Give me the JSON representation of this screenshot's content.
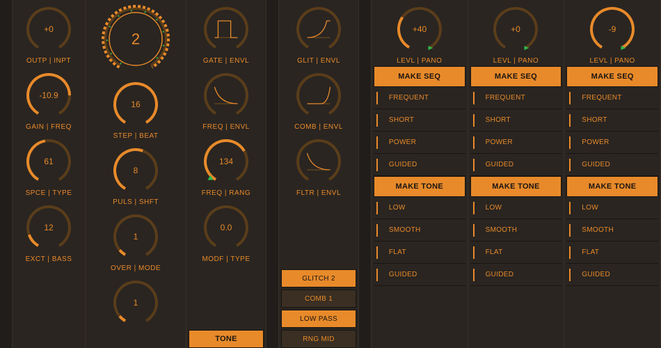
{
  "col1": {
    "k1": {
      "val": "+0",
      "label": "OUTP | INPT",
      "angle": 0
    },
    "k2": {
      "val": "-10.9",
      "label": "GAIN | FREQ",
      "angle": 240
    },
    "k3": {
      "val": "61",
      "label": "SPCE | TYPE",
      "angle": 140
    },
    "k4": {
      "val": "12",
      "label": "EXCT | BASS",
      "angle": 40
    }
  },
  "col2": {
    "k1": {
      "val": "2",
      "label": "",
      "angle": 300,
      "big": true,
      "green": true
    },
    "k2": {
      "val": "16",
      "label": "STEP | BEAT",
      "angle": 300
    },
    "k3": {
      "val": "8",
      "label": "PULS | SHFT",
      "angle": 170
    },
    "k4": {
      "val": "1",
      "label": "OVER | MODE",
      "angle": 20
    },
    "k5": {
      "val": "1",
      "label": "",
      "angle": 20
    }
  },
  "col3": {
    "k1": {
      "val": "",
      "label": "GATE | ENVL",
      "env": "gate"
    },
    "k2": {
      "val": "",
      "label": "FREQ | ENVL",
      "env": "decay"
    },
    "k3": {
      "val": "134",
      "label": "FREQ | RANG",
      "angle": 210,
      "green_tick": true
    },
    "k4": {
      "val": "0.0",
      "label": "MODF | TYPE",
      "angle": 0
    },
    "btn": "TONE"
  },
  "col5": {
    "k1": {
      "val": "",
      "label": "GLIT | ENVL",
      "env": "attack"
    },
    "k2": {
      "val": "",
      "label": "COMB | ENVL",
      "env": "late"
    },
    "k3": {
      "val": "",
      "label": "FLTR | ENVL",
      "env": "decay"
    },
    "buttons": [
      "GLITCH 2",
      "COMB 1",
      "LOW PASS",
      "RNG MID"
    ]
  },
  "right": {
    "knob_label": "LEVL | PANO",
    "seq_hdr": "MAKE SEQ",
    "seq_items": [
      "FREQUENT",
      "SHORT",
      "POWER",
      "GUIDED"
    ],
    "tone_hdr": "MAKE TONE",
    "tone_items": [
      "LOW",
      "SMOOTH",
      "FLAT",
      "GUIDED"
    ],
    "vals": [
      "+40",
      "+0",
      "-9"
    ],
    "angles": [
      95,
      0,
      340
    ]
  }
}
